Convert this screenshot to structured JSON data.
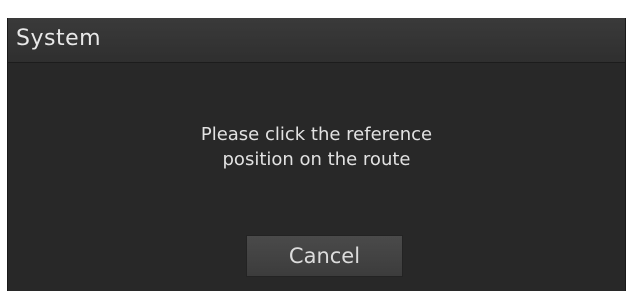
{
  "dialog": {
    "title": "System",
    "message_line1": "Please click the reference",
    "message_line2": "position on the route",
    "cancel_label": "Cancel"
  },
  "colors": {
    "dialog_background": "#282828",
    "titlebar_background": "#353535",
    "text": "#e2e2e2",
    "button_background": "#424242"
  }
}
